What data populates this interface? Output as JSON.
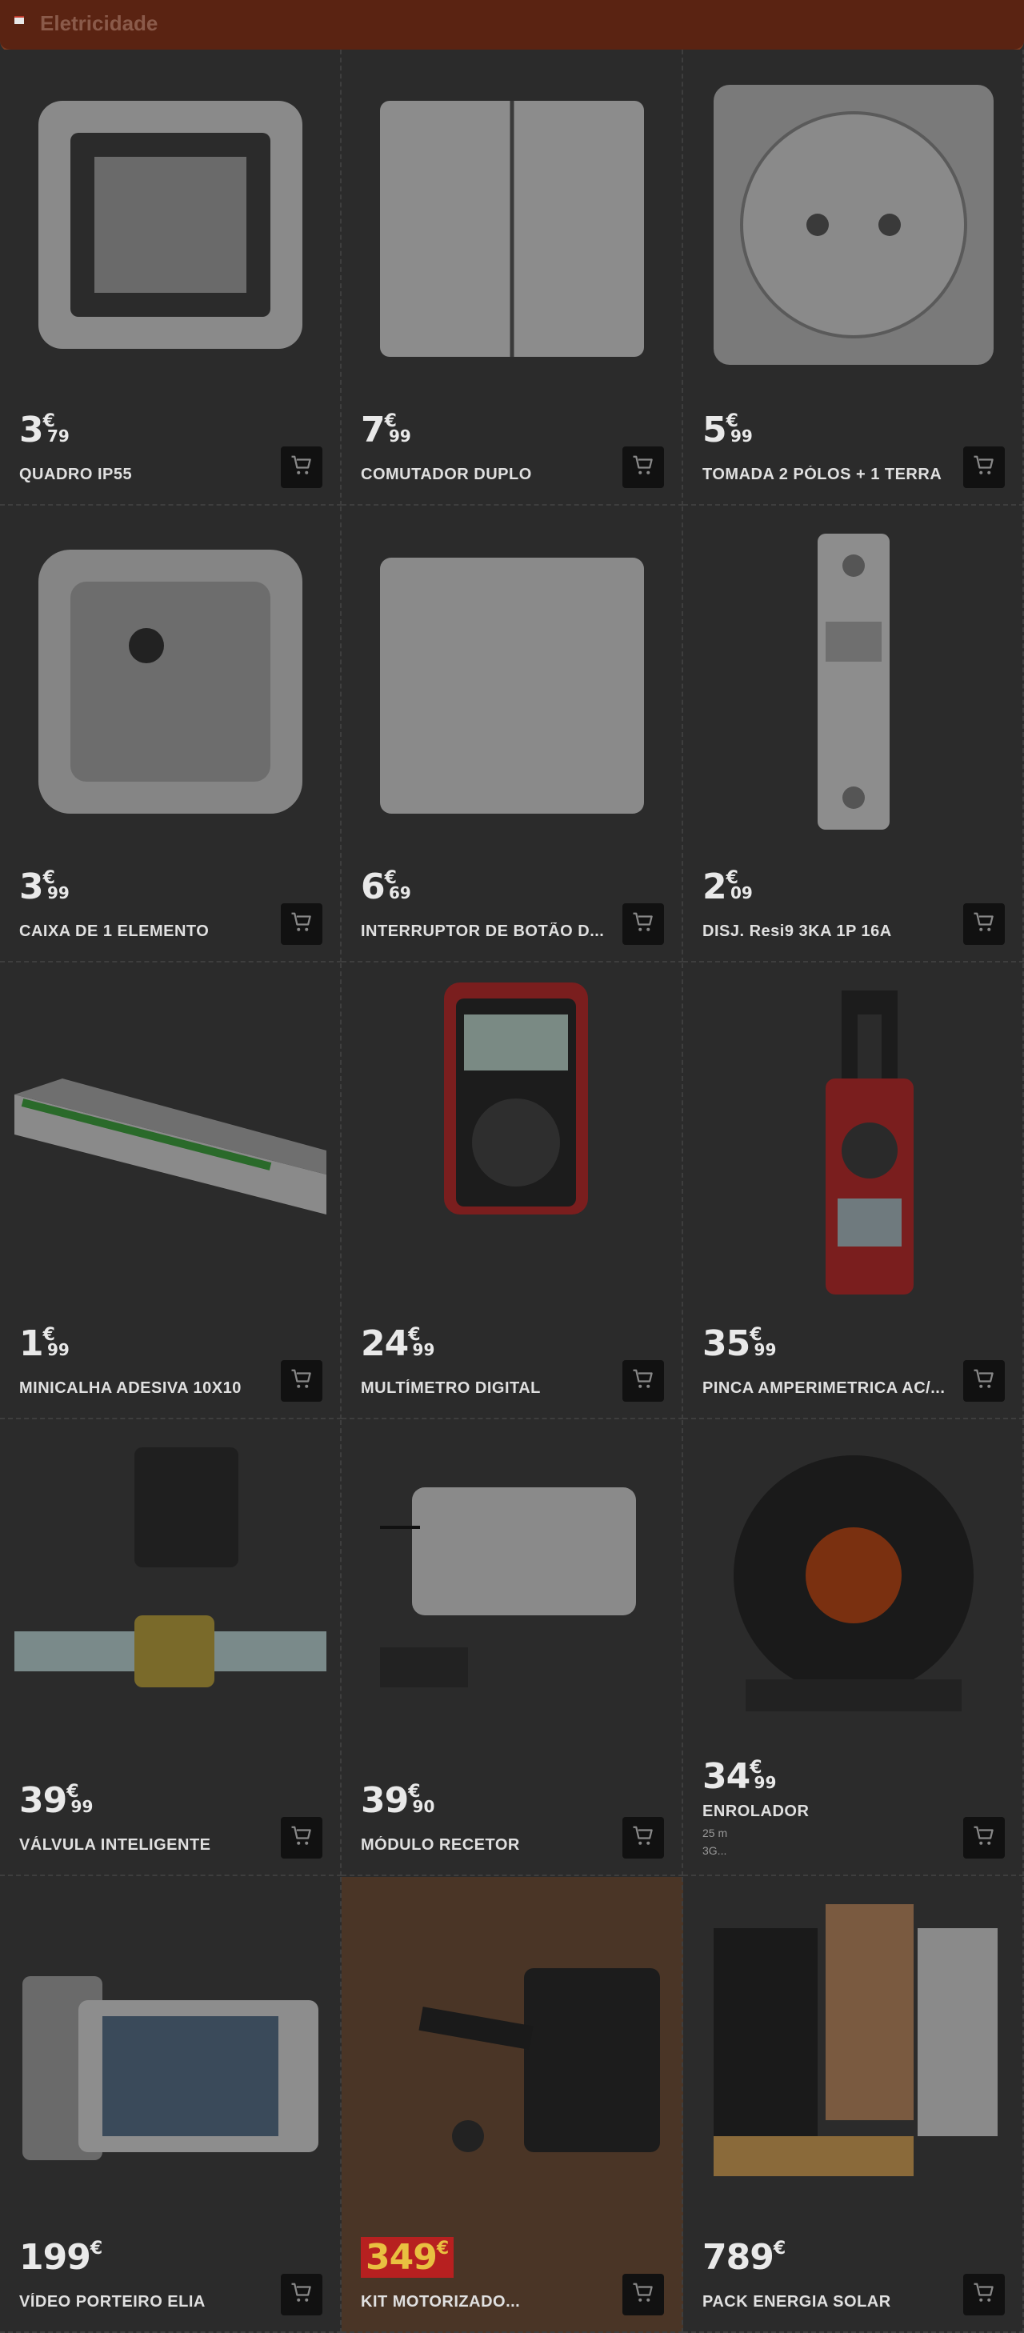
{
  "header": {
    "title": "Eletricidade"
  },
  "products": [
    {
      "name": "QUADRO IP55",
      "price_int": "3",
      "price_cur": "€",
      "price_dec": "79",
      "icon": "frame-icon"
    },
    {
      "name": "COMUTADOR DUPLO",
      "price_int": "7",
      "price_cur": "€",
      "price_dec": "99",
      "icon": "switch-icon"
    },
    {
      "name": "TOMADA 2 PÓLOS + 1 TERRA",
      "price_int": "5",
      "price_cur": "€",
      "price_dec": "99",
      "icon": "socket-icon"
    },
    {
      "name": "CAIXA DE 1 ELEMENTO",
      "price_int": "3",
      "price_cur": "€",
      "price_dec": "99",
      "icon": "box-icon"
    },
    {
      "name": "INTERRUPTOR DE BOTÃO D...",
      "price_int": "6",
      "price_cur": "€",
      "price_dec": "69",
      "icon": "button-switch-icon"
    },
    {
      "name": "DISJ. Resi9 3KA 1P 16A",
      "price_int": "2",
      "price_cur": "€",
      "price_dec": "09",
      "icon": "breaker-icon"
    },
    {
      "name": "MINICALHA ADESIVA 10X10",
      "price_int": "1",
      "price_cur": "€",
      "price_dec": "99",
      "icon": "trunking-icon"
    },
    {
      "name": "MULTÍMETRO DIGITAL",
      "price_int": "24",
      "price_cur": "€",
      "price_dec": "99",
      "icon": "multimeter-icon"
    },
    {
      "name": "PINCA AMPERIMETRICA AC/...",
      "price_int": "35",
      "price_cur": "€",
      "price_dec": "99",
      "icon": "clamp-meter-icon"
    },
    {
      "name": "VÁLVULA INTELIGENTE",
      "price_int": "39",
      "price_cur": "€",
      "price_dec": "99",
      "icon": "valve-icon"
    },
    {
      "name": "MÓDULO RECETOR",
      "price_int": "39",
      "price_cur": "€",
      "price_dec": "90",
      "icon": "receiver-icon"
    },
    {
      "name": "ENROLADOR",
      "price_int": "34",
      "price_cur": "€",
      "price_dec": "99",
      "icon": "cable-reel-icon",
      "sub1": "25 m",
      "sub2": "3G..."
    },
    {
      "name": "VÍDEO PORTEIRO ELIA",
      "price_int": "199",
      "price_cur": "€",
      "price_dec": "",
      "icon": "video-intercom-icon"
    },
    {
      "name": "KIT MOTORIZADO...",
      "price_int": "349",
      "price_cur": "€",
      "price_dec": "",
      "icon": "gate-motor-icon",
      "promo": true
    },
    {
      "name": "PACK ENERGIA SOLAR",
      "price_int": "789",
      "price_cur": "€",
      "price_dec": "",
      "icon": "solar-pack-icon"
    }
  ]
}
